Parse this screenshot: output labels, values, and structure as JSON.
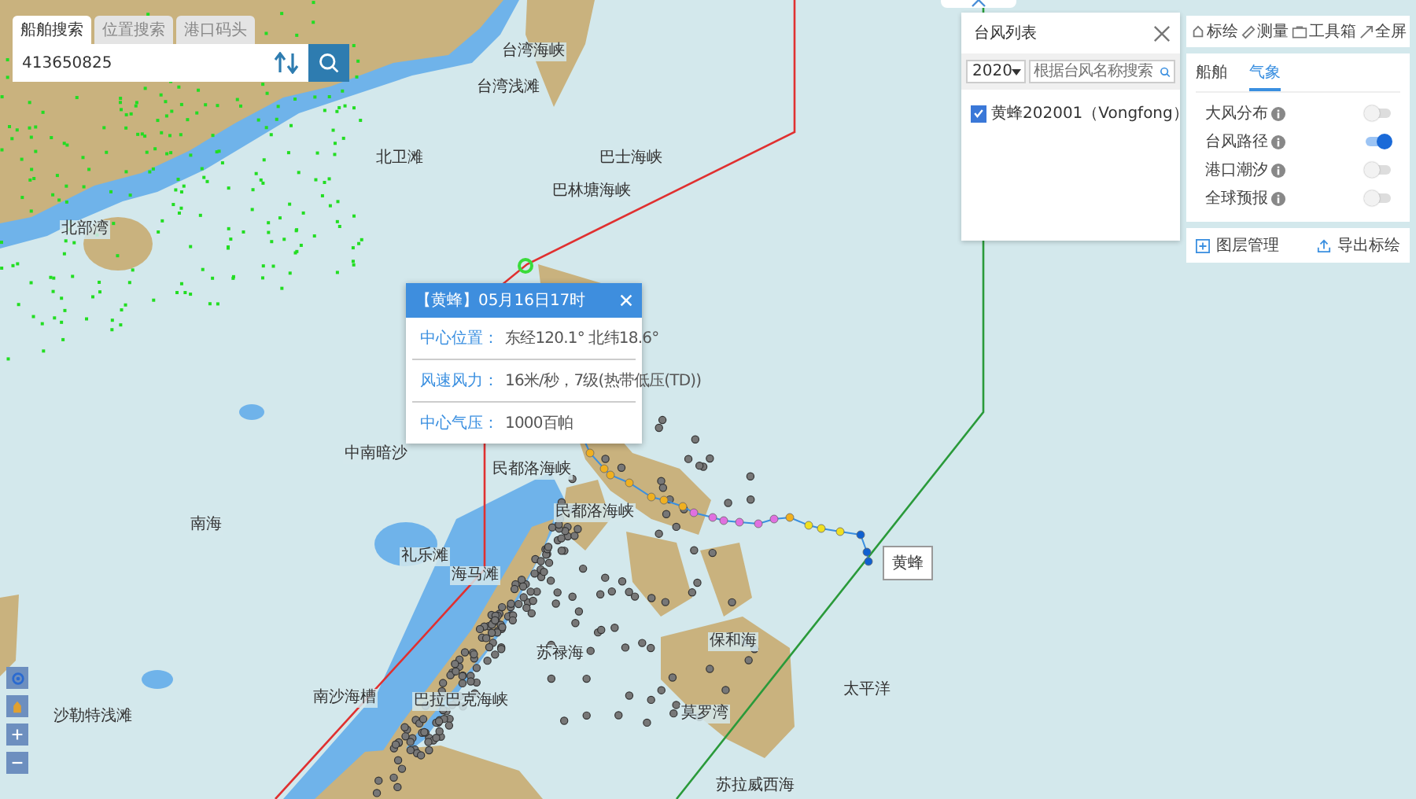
{
  "search_panel": {
    "tabs": [
      {
        "label": "船舶搜索",
        "selected": true
      },
      {
        "label": "位置搜索",
        "selected": false
      },
      {
        "label": "港口码头",
        "selected": false
      }
    ],
    "value": "413650825"
  },
  "typhoon_list": {
    "title": "台风列表",
    "year": "2020",
    "placeholder": "根据台风名称搜索",
    "items": [
      {
        "label": "黄蜂202001（Vongfong）",
        "checked": true
      }
    ]
  },
  "toolbar": {
    "buttons": [
      {
        "kind": "plot",
        "label": "标绘"
      },
      {
        "kind": "measure",
        "label": "测量"
      },
      {
        "kind": "toolbox",
        "label": "工具箱"
      },
      {
        "kind": "fullscreen",
        "label": "全屏"
      }
    ]
  },
  "layers_panel": {
    "tabs": [
      {
        "label": "船舶",
        "selected": false
      },
      {
        "label": "气象",
        "selected": true
      }
    ],
    "toggles": [
      {
        "label": "大风分布",
        "on": false
      },
      {
        "label": "台风路径",
        "on": true
      },
      {
        "label": "港口潮汐",
        "on": false
      },
      {
        "label": "全球预报",
        "on": false
      }
    ]
  },
  "layer_bar": {
    "manage": "图层管理",
    "export": "导出标绘"
  },
  "popup": {
    "title": "【黄蜂】05月16日17时",
    "rows": [
      {
        "label": "中心位置：",
        "value": "东经120.1° 北纬18.6°"
      },
      {
        "label": "风速风力：",
        "value": "16米/秒，7级(热带低压(TD))"
      },
      {
        "label": "中心气压：",
        "value": "1000百帕"
      }
    ]
  },
  "typhoon_label": "黄蜂",
  "map_labels": [
    "台湾海峡",
    "台湾浅滩",
    "北卫滩",
    "巴士海峡",
    "巴林塘海峡",
    "北部湾",
    "中南暗沙",
    "民都洛海峡",
    "民都洛海峡",
    "礼乐滩",
    "海马滩",
    "南海",
    "苏禄海",
    "保和海",
    "太平洋",
    "南沙海槽",
    "巴拉巴克海峡",
    "莫罗湾",
    "苏拉威西海",
    "沙勒特浅滩"
  ]
}
